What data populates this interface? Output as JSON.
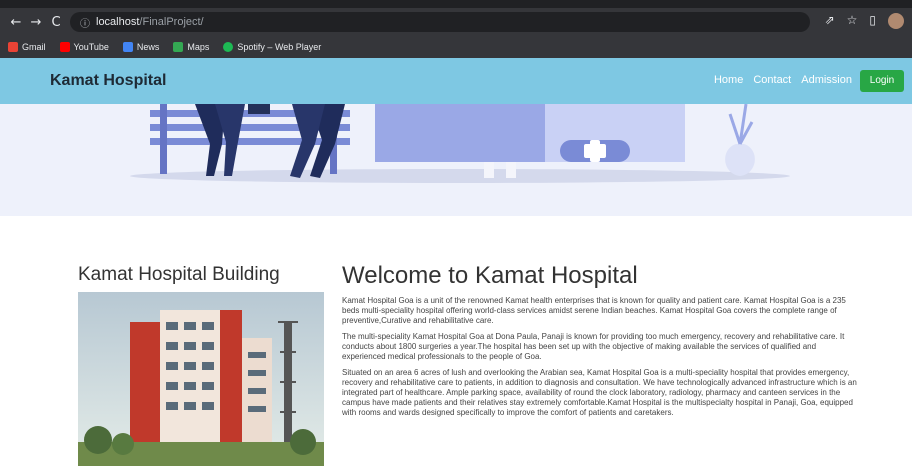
{
  "browser": {
    "nav": {
      "back": "←",
      "forward": "→",
      "reload": "C",
      "home": "⌂"
    },
    "url_host": "localhost",
    "url_path": "/FinalProject/",
    "right_icons": {
      "share": "⇗",
      "star": "☆",
      "split": "▯"
    },
    "bookmarks": [
      {
        "label": "Gmail",
        "color": "#ea4335"
      },
      {
        "label": "YouTube",
        "color": "#ff0000"
      },
      {
        "label": "News",
        "color": "#4285f4"
      },
      {
        "label": "Maps",
        "color": "#34a853"
      },
      {
        "label": "Spotify – Web Player",
        "color": "#1db954"
      }
    ]
  },
  "navbar": {
    "brand": "Kamat Hospital",
    "links": [
      "Home",
      "Contact",
      "Admission"
    ],
    "login": "Login",
    "background": "#7ec8e3",
    "login_color": "#28a745"
  },
  "sidebar": {
    "title": "Kamat Hospital Building"
  },
  "main": {
    "title": "Welcome to Kamat Hospital",
    "paragraphs": [
      "Kamat Hospital Goa is a unit of the renowned Kamat health enterprises that is known for quality and patient care. Kamat Hospital Goa is a 235 beds multi-speciality hospital offering world-class services amidst serene Indian beaches. Kamat Hospital Goa covers the complete range of preventive,Curative and rehabilitative care.",
      "The multi-speciality Kamat Hospital Goa at Dona Paula, Panaji is known for providing too much emergency, recovery and rehabilitative care. It conducts about 1800 surgeries a year.The hospital has been set up with the objective of making available the services of qualified and experienced medical professionals to the people of Goa.",
      "Situated on an area 6 acres of lush and overlooking the Arabian sea, Kamat Hospital Goa is a multi-speciality hospital that provides emergency, recovery and rehabilitative care to patients, in addition to diagnosis and consultation. We have technologically advanced infrastructure which is an integrated part of healthcare. Ample parking space, availability of round the clock laboratory, radiology, pharmacy and canteen services in the campus have made patients and their relatives stay extremely comfortable.Kamat Hospital is the multispecialty hospital in Panaji, Goa, equipped with rooms and wards designed specifically to improve the comfort of patients and caretakers."
    ]
  }
}
